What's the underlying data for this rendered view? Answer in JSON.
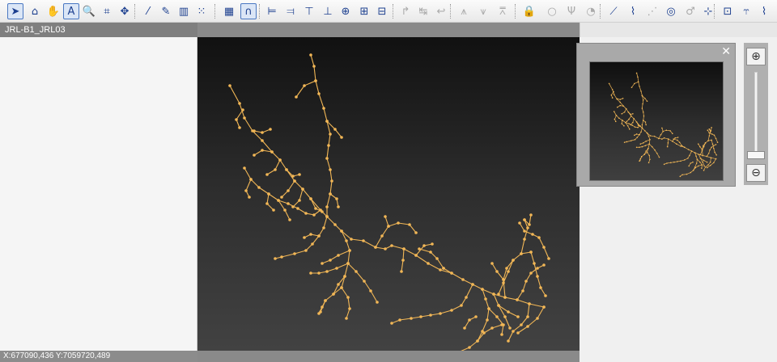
{
  "window_title": "JRL-B1_JRL03",
  "status": {
    "coords": "X:677090,436 Y:7059720,489"
  },
  "overview": {
    "close": "✕"
  },
  "zoom": {
    "in": "⊕",
    "out": "⊖"
  },
  "colors": {
    "network": "#f2b756",
    "canvas_top": "#111111",
    "canvas_bottom": "#454545"
  },
  "toolbar": [
    {
      "name": "select-tool-icon",
      "glyph": "➤",
      "active": true
    },
    {
      "name": "home-extent-icon",
      "glyph": "⌂"
    },
    {
      "name": "pan-hand-icon",
      "glyph": "✋"
    },
    {
      "name": "label-text-icon",
      "glyph": "A",
      "active": true
    },
    {
      "name": "zoom-tool-icon",
      "glyph": "🔍"
    },
    {
      "name": "zoom-extent-icon",
      "glyph": "⌗"
    },
    {
      "name": "move-cross-icon",
      "glyph": "✥"
    },
    {
      "name": "measure-icon",
      "glyph": "⁄"
    },
    {
      "name": "pencil-edit-icon",
      "glyph": "✎"
    },
    {
      "name": "layer-panel-icon",
      "glyph": "▥"
    },
    {
      "name": "grid-points-icon",
      "glyph": "⁙"
    },
    {
      "name": "grid-icon",
      "glyph": "▦"
    },
    {
      "name": "snap-magnet-icon",
      "glyph": "∩",
      "active": true
    },
    {
      "name": "align-left-icon",
      "glyph": "⊨"
    },
    {
      "name": "align-right-icon",
      "glyph": "⫤"
    },
    {
      "name": "align-top-icon",
      "glyph": "⊤"
    },
    {
      "name": "align-bottom-icon",
      "glyph": "⊥"
    },
    {
      "name": "align-center-icon",
      "glyph": "⊕"
    },
    {
      "name": "distribute-icon",
      "glyph": "⊞"
    },
    {
      "name": "distribute-grid-icon",
      "glyph": "⊟"
    },
    {
      "name": "rotate-icon",
      "glyph": "↱",
      "disabled": true
    },
    {
      "name": "flip-icon",
      "glyph": "↹",
      "disabled": true
    },
    {
      "name": "undo-arrow-icon",
      "glyph": "↩",
      "disabled": true
    },
    {
      "name": "tower-icon",
      "glyph": "⩚",
      "disabled": true
    },
    {
      "name": "tower-add-icon",
      "glyph": "⩛",
      "disabled": true
    },
    {
      "name": "tower-remove-icon",
      "glyph": "⩞",
      "disabled": true
    },
    {
      "name": "lock-icon",
      "glyph": "🔒",
      "gold": true
    },
    {
      "name": "node-circle-icon",
      "glyph": "○",
      "disabled": true
    },
    {
      "name": "pole-icon",
      "glyph": "Ψ",
      "disabled": true
    },
    {
      "name": "meter-icon",
      "glyph": "◔",
      "disabled": true
    },
    {
      "name": "line-draw-icon",
      "glyph": "⟋"
    },
    {
      "name": "polyline-icon",
      "glyph": "⌇"
    },
    {
      "name": "poly-segment-icon",
      "glyph": "⋰",
      "disabled": true
    },
    {
      "name": "target-node-icon",
      "glyph": "◎"
    },
    {
      "name": "arrow-node-icon",
      "glyph": "♂",
      "disabled": true
    },
    {
      "name": "crosshair-node-icon",
      "glyph": "⊹"
    },
    {
      "name": "switch-icon",
      "glyph": "⊡"
    },
    {
      "name": "branch-icon",
      "glyph": "⥾"
    },
    {
      "name": "fuse-icon",
      "glyph": "⌇"
    }
  ]
}
